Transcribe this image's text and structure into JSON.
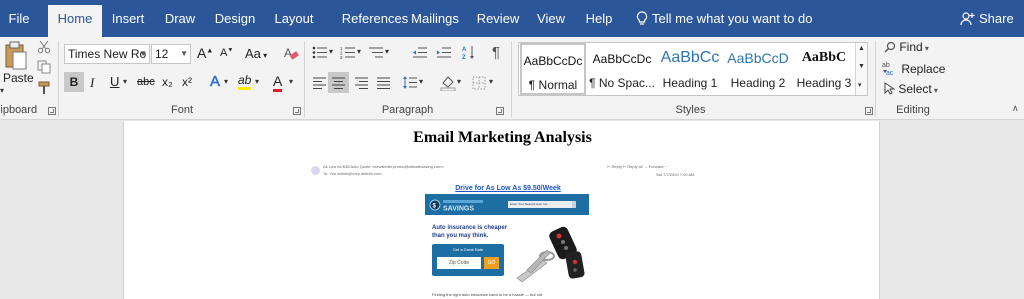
{
  "tabs": [
    "File",
    "Home",
    "Insert",
    "Draw",
    "Design",
    "Layout",
    "References",
    "Mailings",
    "Review",
    "View",
    "Help"
  ],
  "tell_me": "Tell me what you want to do",
  "share": "Share",
  "clipboard": {
    "paste": "Paste",
    "label": "Clipboard"
  },
  "font": {
    "name": "Times New Ro",
    "size": "12",
    "label": "Font",
    "grow": "A",
    "shrink": "A",
    "case": "Aa",
    "bold": "B",
    "italic": "I",
    "underline": "U",
    "strike": "abc",
    "subscript": "x₂",
    "superscript": "x²",
    "effects": "A",
    "highlight": "ab",
    "color": "A"
  },
  "paragraph": {
    "label": "Paragraph",
    "pilcrow": "¶"
  },
  "styles": {
    "label": "Styles",
    "items": [
      {
        "sample": "AaBbCcDc",
        "name": "¶ Normal"
      },
      {
        "sample": "AaBbCcDc",
        "name": "¶ No Spac..."
      },
      {
        "sample": "AaBbCc",
        "name": "Heading 1"
      },
      {
        "sample": "AaBbCcD",
        "name": "Heading 2"
      },
      {
        "sample": "AaBbC",
        "name": "Heading 3"
      }
    ]
  },
  "editing": {
    "label": "Editing",
    "find": "Find",
    "replace": "Replace",
    "select": "Select"
  },
  "document": {
    "title": "Email Marketing Analysis",
    "email": {
      "from": "As Low As $38 Auto Quote <newsletter.promo@allstatesaving.com>",
      "to": "To: You   admin@corp.ahlinfo.com",
      "actions": "↩ Reply   ↩ Reply all   → Forward   ⋯",
      "date": "Sat 7/7/2020 7:00 AM",
      "headline": "Drive for As Low As $9.50/Week",
      "search_placeholder": "Enter Your Nearest Auto Ins...",
      "pitch_line1": "Auto insurance is cheaper",
      "pitch_line2": "than you may think.",
      "rate_title": "Get a Great Rate",
      "zip_placeholder": "Zip Code",
      "go": "GO",
      "body": "Finding the right auto insurance used to be a hassle — but not"
    }
  },
  "colors": {
    "brand": "#2b579a",
    "promo_blue": "#1d6ea3",
    "go_orange": "#f0a020"
  }
}
